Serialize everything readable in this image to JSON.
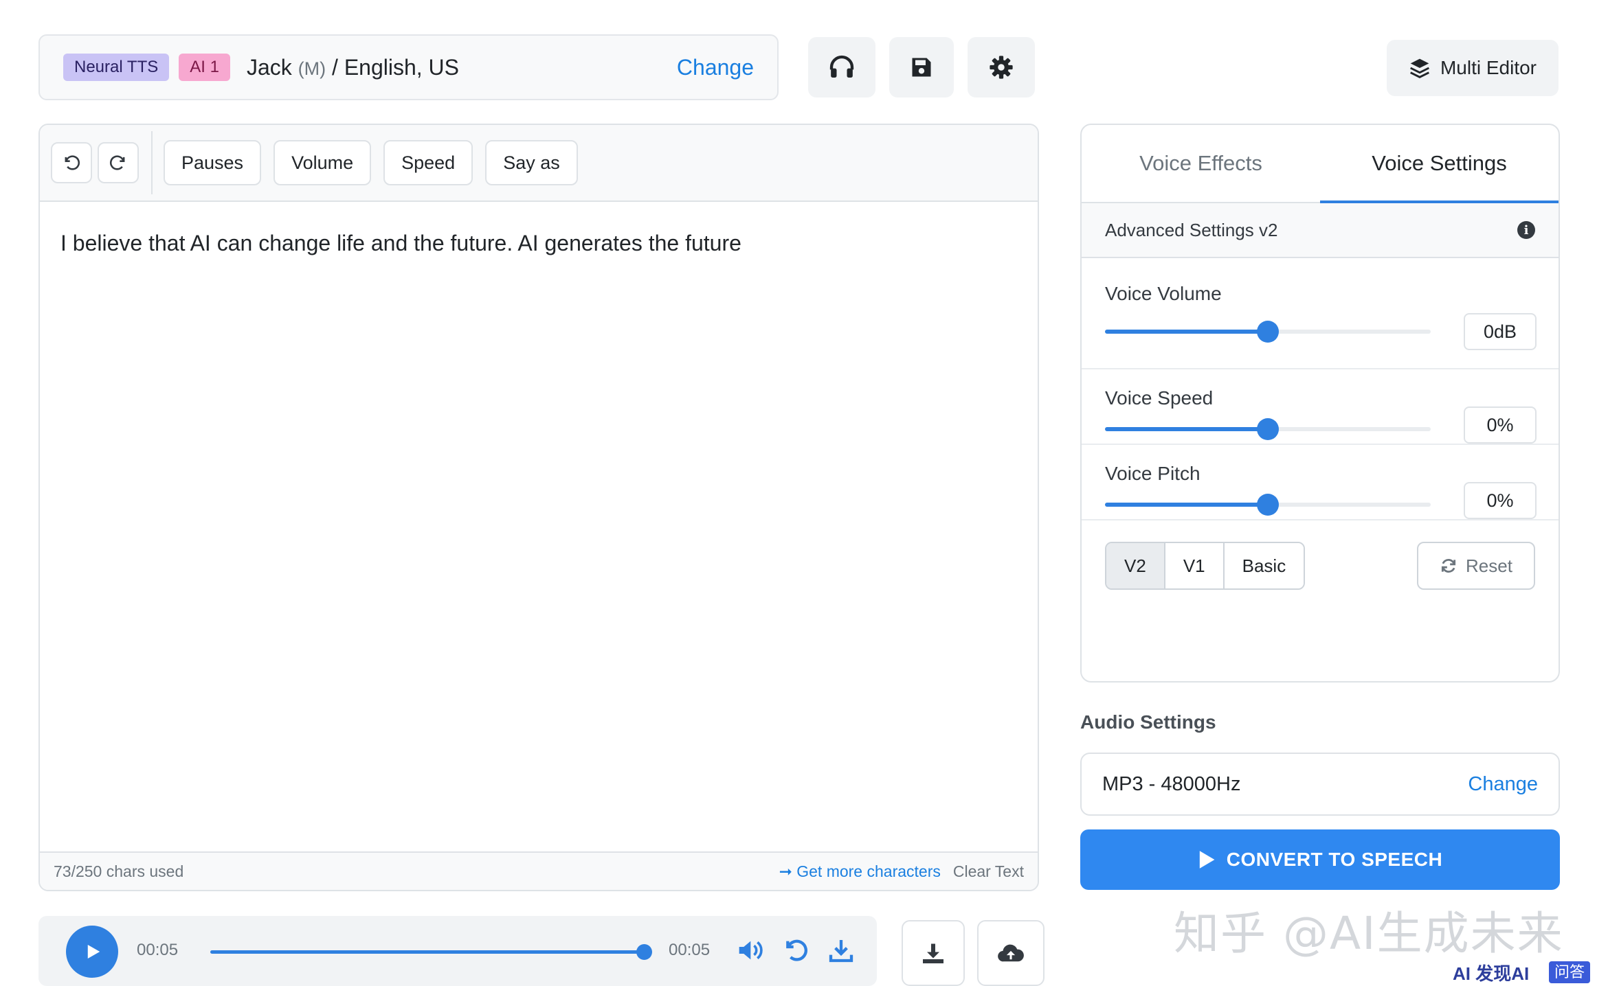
{
  "voice_bar": {
    "badge_neural": "Neural TTS",
    "badge_ai": "AI 1",
    "voice_name": "Jack",
    "voice_gender": "(M)",
    "voice_locale": "/ English, US",
    "change_label": "Change"
  },
  "toolbar_icons": [
    "headphones-icon",
    "save-icon",
    "gear-icon"
  ],
  "multi_editor": {
    "label": "Multi Editor",
    "icon": "layers-icon"
  },
  "editor": {
    "tools": [
      "Pauses",
      "Volume",
      "Speed",
      "Say as"
    ],
    "text": "I believe that AI can change life and the future. AI generates the future",
    "chars_used": "73/250 chars used",
    "get_more": "Get more characters",
    "clear_text": "Clear Text"
  },
  "player": {
    "current_time": "00:05",
    "duration": "00:05",
    "progress_fraction": 1.0
  },
  "settings": {
    "tabs": [
      {
        "label": "Voice Effects",
        "active": false
      },
      {
        "label": "Voice Settings",
        "active": true
      }
    ],
    "advanced_title": "Advanced Settings v2",
    "sliders": [
      {
        "label": "Voice Volume",
        "value": "0dB",
        "level": 0.5
      },
      {
        "label": "Voice Speed",
        "value": "0%",
        "level": 0.5
      },
      {
        "label": "Voice Pitch",
        "value": "0%",
        "level": 0.5
      }
    ],
    "versions": [
      {
        "label": "V2",
        "active": true
      },
      {
        "label": "V1",
        "active": false
      },
      {
        "label": "Basic",
        "active": false
      }
    ],
    "reset_label": "Reset"
  },
  "audio": {
    "title": "Audio Settings",
    "format": "MP3 - 48000Hz",
    "change_label": "Change"
  },
  "convert_label": "CONVERT TO SPEECH",
  "watermark": {
    "text": "知乎 @AI生成未来",
    "logo": "AI 发现AI",
    "badge": "问答"
  },
  "colors": {
    "accent": "#2f80e0",
    "link": "#1a7fe0",
    "badge_neural": "#c9c3f5",
    "badge_ai": "#f7a8d0"
  }
}
